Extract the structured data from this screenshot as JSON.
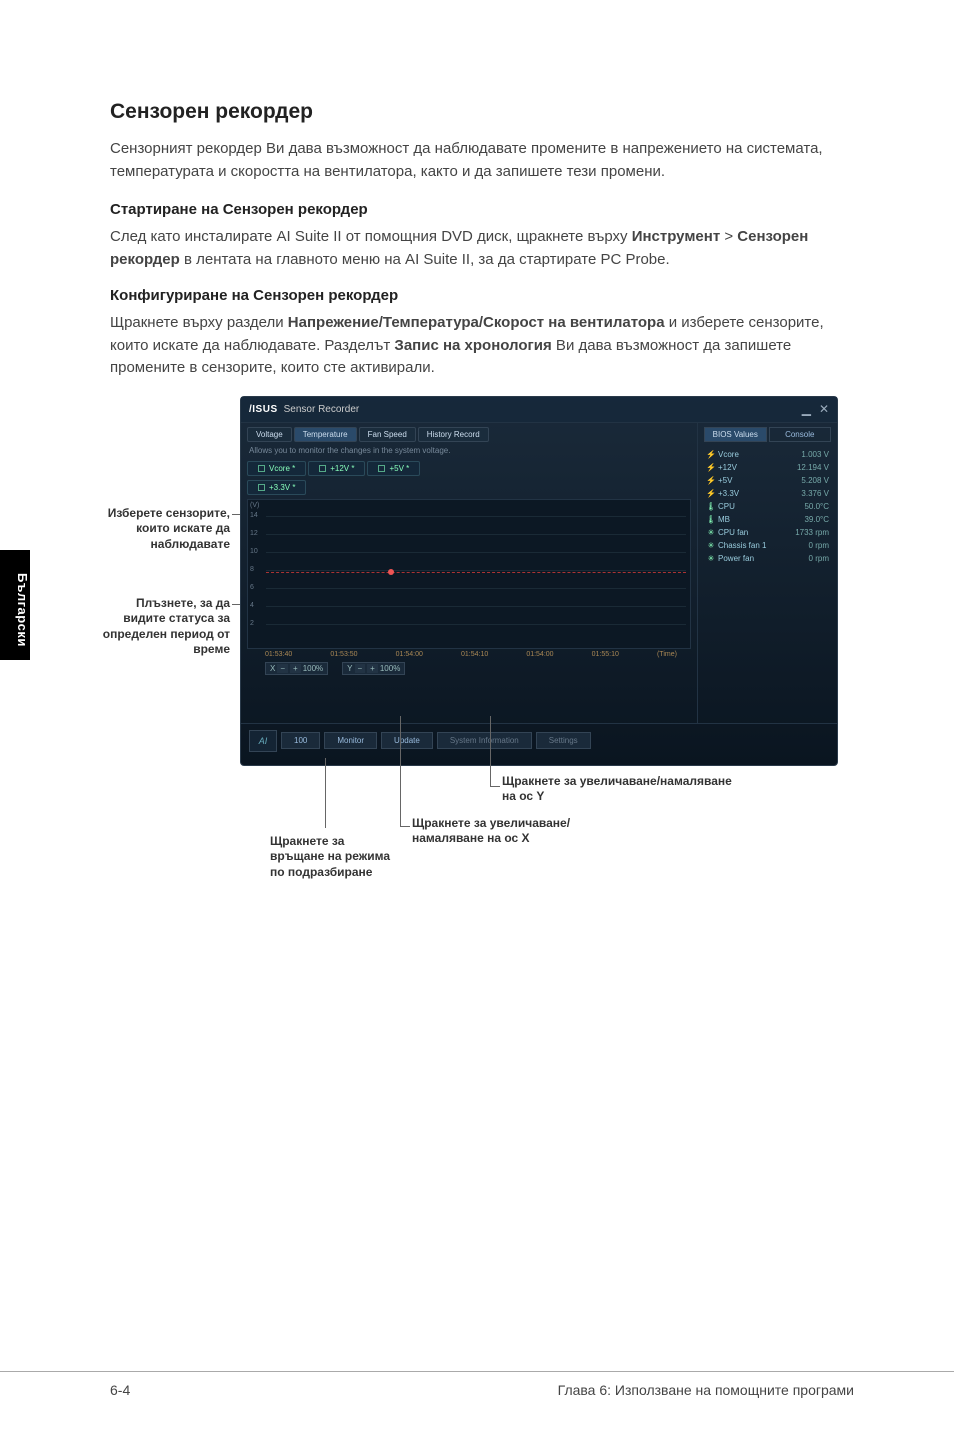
{
  "sideTab": "Български",
  "heading": "Сензорен рекордер",
  "intro": "Сензорният рекордер Ви дава възможност да наблюдавате промените в напрежението на системата, температурата и скоростта на вентилатора, както и да запишете тези промени.",
  "sub1_title": "Стартиране на Сензорен рекордер",
  "sub1_text_a": "След като инсталирате AI Suite II от помощния DVD диск, щракнете върху ",
  "sub1_bold1": "Инструмент",
  "sub1_text_b": " > ",
  "sub1_bold2": "Сензорен рекордер",
  "sub1_text_c": " в лентата на главното меню на AI Suite II, за да стартирате PC Probe.",
  "sub2_title": "Конфигуриране на Сензорен рекордер",
  "sub2_text_a": "Щракнете върху раздели ",
  "sub2_bold1": "Напрежение/Температура/Скорост на вентилатора",
  "sub2_text_b": " и изберете сензорите, които искате да наблюдавате. Разделът ",
  "sub2_bold2": "Запис на хронология",
  "sub2_text_c": " Ви дава възможност да запишете промените в сензорите, които сте активирали.",
  "app": {
    "logo": "/ISUS",
    "title": "Sensor Recorder",
    "tabs": [
      "Voltage",
      "Temperature",
      "Fan Speed",
      "History Record"
    ],
    "subtext": "Allows you to monitor the changes in the system voltage.",
    "sensors": [
      "Vcore *",
      "+12V *",
      "+5V *",
      "+3.3V *"
    ],
    "ylabels": [
      "14",
      "12",
      "10",
      "8",
      "6",
      "4",
      "2"
    ],
    "ylabel": "(V)",
    "xlabels": [
      "01:53:40",
      "01:53:50",
      "01:54:00",
      "01:54:10",
      "01:54:00",
      "01:55:10"
    ],
    "xunit": "(Time)",
    "zoomX": "100%",
    "zoomY": "100%",
    "statusTabs": [
      "BIOS Values",
      "Console"
    ],
    "statusRows": [
      {
        "ic": "⚡",
        "nm": "Vcore",
        "vl": "1.003 V"
      },
      {
        "ic": "⚡",
        "nm": "+12V",
        "vl": "12.194 V"
      },
      {
        "ic": "⚡",
        "nm": "+5V",
        "vl": "5.208 V"
      },
      {
        "ic": "⚡",
        "nm": "+3.3V",
        "vl": "3.376 V"
      },
      {
        "ic": "🌡",
        "nm": "CPU",
        "vl": "50.0°C"
      },
      {
        "ic": "🌡",
        "nm": "MB",
        "vl": "39.0°C"
      },
      {
        "ic": "✳",
        "nm": "CPU fan",
        "vl": "1733 rpm"
      },
      {
        "ic": "✳",
        "nm": "Chassis fan 1",
        "vl": "0 rpm"
      },
      {
        "ic": "✳",
        "nm": "Power fan",
        "vl": "0 rpm"
      }
    ],
    "bottom": [
      "100",
      "Monitor",
      "Update",
      "System Information",
      "Settings"
    ]
  },
  "callouts": {
    "selectSensors": "Изберете сензорите, които искате да наблюдавате",
    "dragStatus": "Плъзнете, за да видите статуса за определен период от време",
    "zoomY": "Щракнете за увеличаване/намаляване на ос Y",
    "zoomX": "Щракнете за увеличаване/намаляване на ос X",
    "defaultMode": "Щракнете за връщане на режима по подразбиране"
  },
  "footer": {
    "left": "6-4",
    "right": "Глава 6: Използване на помощните програми"
  }
}
